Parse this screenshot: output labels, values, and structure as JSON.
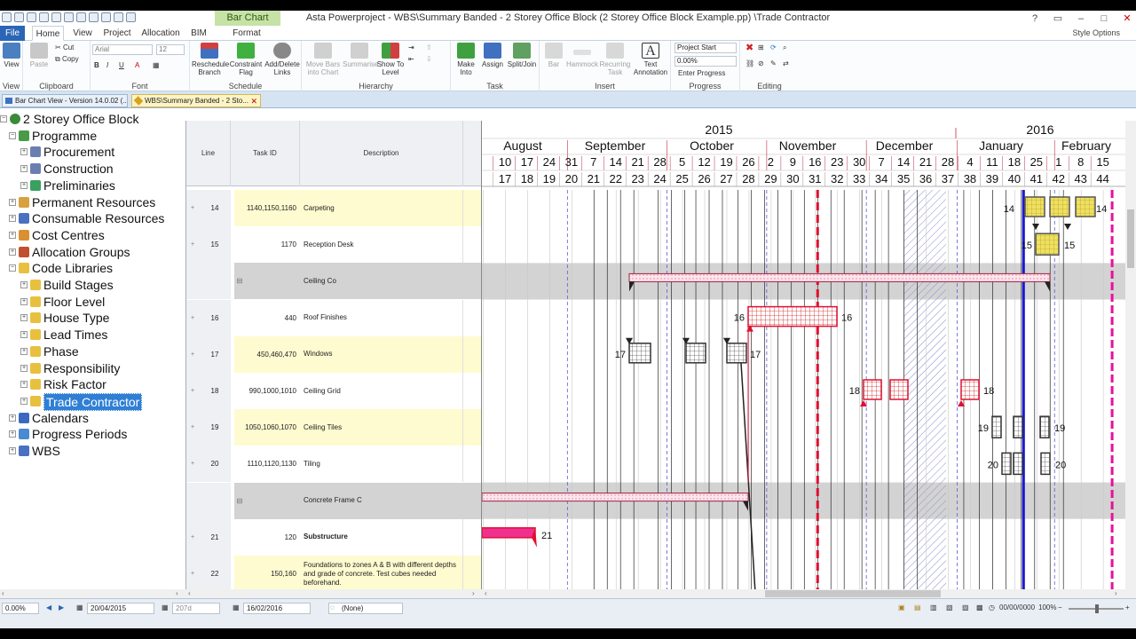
{
  "window": {
    "title": "Asta Powerproject - WBS\\Summary Banded - 2 Storey Office Block (2 Storey Office Block Example.pp) \\Trade Contractor",
    "context_tab": "Bar Chart Tools"
  },
  "ribbon_tabs": [
    "File",
    "Home",
    "View",
    "Project",
    "Allocation",
    "BIM",
    "Format"
  ],
  "style_options": "Style Options",
  "ribbon": {
    "view": "View",
    "paste": "Paste",
    "cut": "Cut",
    "copy": "Copy",
    "font_name": "Arial",
    "font_size": "12",
    "reschedule": "Reschedule",
    "branch": "Branch",
    "constraint": "Constraint",
    "flag": "Flag",
    "add_delete": "Add/Delete",
    "links": "Links",
    "move_bars": "Move Bars",
    "into_chart": "into Chart",
    "summarise": "Summarise",
    "show_to": "Show To",
    "level": "Level",
    "make": "Make",
    "into": "Into",
    "assign": "Assign",
    "split_join": "Split/Join",
    "bar": "Bar",
    "hammock": "Hammock",
    "recurring": "Recurring",
    "task": "Task",
    "text": "Text",
    "annotation": "Annotation",
    "project_start": "Project Start",
    "progress_value": "0.00%",
    "enter_progress": "Enter Progress",
    "groups": [
      "Clipboard",
      "Font",
      "Schedule",
      "Hierarchy",
      "Task",
      "Insert",
      "Progress",
      "Editing"
    ]
  },
  "doc_tabs": [
    {
      "label": "Bar Chart View - Version 14.0.02 (..."
    },
    {
      "label": "WBS\\Summary Banded - 2 Sto..."
    }
  ],
  "tree": [
    {
      "label": "2 Storey Office Block",
      "level": 0,
      "icon": "globe-icon",
      "color": "#3a8a3a"
    },
    {
      "label": "Programme",
      "level": 1,
      "icon": "programme-icon",
      "color": "#4a9a4a"
    },
    {
      "label": "Procurement",
      "level": 2,
      "icon": "folder-icon",
      "color": "#6a7fb0"
    },
    {
      "label": "Construction",
      "level": 2,
      "icon": "folder-icon",
      "color": "#6a7fb0"
    },
    {
      "label": "Preliminaries",
      "level": 2,
      "icon": "folder-icon",
      "color": "#3aa060"
    },
    {
      "label": "Permanent Resources",
      "level": 1,
      "icon": "person-icon",
      "color": "#d8a040"
    },
    {
      "label": "Consumable Resources",
      "level": 1,
      "icon": "cube-icon",
      "color": "#4a70c0"
    },
    {
      "label": "Cost Centres",
      "level": 1,
      "icon": "cost-icon",
      "color": "#d89030"
    },
    {
      "label": "Allocation Groups",
      "level": 1,
      "icon": "group-icon",
      "color": "#c05030"
    },
    {
      "label": "Code Libraries",
      "level": 1,
      "icon": "folder-icon",
      "color": "#e8c040"
    },
    {
      "label": "Build Stages",
      "level": 2,
      "icon": "folder-icon",
      "color": "#e8c040"
    },
    {
      "label": "Floor Level",
      "level": 2,
      "icon": "folder-icon",
      "color": "#e8c040"
    },
    {
      "label": "House Type",
      "level": 2,
      "icon": "folder-icon",
      "color": "#e8c040"
    },
    {
      "label": "Lead Times",
      "level": 2,
      "icon": "folder-icon",
      "color": "#e8c040"
    },
    {
      "label": "Phase",
      "level": 2,
      "icon": "folder-icon",
      "color": "#e8c040"
    },
    {
      "label": "Responsibility",
      "level": 2,
      "icon": "folder-icon",
      "color": "#e8c040"
    },
    {
      "label": "Risk Factor",
      "level": 2,
      "icon": "folder-icon",
      "color": "#e8c040"
    },
    {
      "label": "Trade Contractor",
      "level": 2,
      "icon": "folder-icon",
      "color": "#e8c040",
      "selected": true
    },
    {
      "label": "Calendars",
      "level": 1,
      "icon": "calendar-icon",
      "color": "#3a6ac0"
    },
    {
      "label": "Progress Periods",
      "level": 1,
      "icon": "progress-icon",
      "color": "#4a8ad0"
    },
    {
      "label": "WBS",
      "level": 1,
      "icon": "wbs-icon",
      "color": "#4a70c0"
    }
  ],
  "grid": {
    "headers": {
      "line": "Line",
      "task_id": "Task ID",
      "description": "Description"
    },
    "rows": [
      {
        "line": "14",
        "task_id": "1140,1150,1160",
        "desc": "Carpeting",
        "type": "task",
        "band": "yellow"
      },
      {
        "line": "15",
        "task_id": "1170",
        "desc": "Reception Desk",
        "type": "task",
        "band": "white"
      },
      {
        "line": "",
        "task_id": "",
        "desc": "Ceiling Co",
        "type": "group"
      },
      {
        "line": "16",
        "task_id": "440",
        "desc": "Roof Finishes",
        "type": "task",
        "band": "white"
      },
      {
        "line": "17",
        "task_id": "450,460,470",
        "desc": "Windows",
        "type": "task",
        "band": "yellow"
      },
      {
        "line": "18",
        "task_id": "990,1000,1010",
        "desc": "Ceiling Grid",
        "type": "task",
        "band": "white"
      },
      {
        "line": "19",
        "task_id": "1050,1060,1070",
        "desc": "Ceiling Tiles",
        "type": "task",
        "band": "yellow"
      },
      {
        "line": "20",
        "task_id": "1110,1120,1130",
        "desc": "Tiling",
        "type": "task",
        "band": "white"
      },
      {
        "line": "",
        "task_id": "",
        "desc": "Concrete Frame C",
        "type": "group"
      },
      {
        "line": "21",
        "task_id": "120",
        "desc": "Substructure",
        "type": "task",
        "band": "white",
        "bold": true
      },
      {
        "line": "22",
        "task_id": "150,160",
        "desc": "Foundations to zones A & B with different depths and grade of concrete. Test cubes needed beforehand.",
        "type": "task",
        "band": "yellow"
      }
    ]
  },
  "timescale": {
    "years": [
      {
        "label": "2015"
      },
      {
        "label": "2016"
      }
    ],
    "months": [
      "August",
      "September",
      "October",
      "November",
      "December",
      "January",
      "February"
    ],
    "days": [
      "10",
      "17",
      "24",
      "31",
      "7",
      "14",
      "21",
      "28",
      "5",
      "12",
      "19",
      "26",
      "2",
      "9",
      "16",
      "23",
      "30",
      "7",
      "14",
      "21",
      "28",
      "4",
      "11",
      "18",
      "25",
      "1",
      "8",
      "15"
    ],
    "weeks": [
      "17",
      "18",
      "19",
      "20",
      "21",
      "22",
      "23",
      "24",
      "25",
      "26",
      "27",
      "28",
      "29",
      "30",
      "31",
      "32",
      "33",
      "34",
      "35",
      "36",
      "37",
      "38",
      "39",
      "40",
      "41",
      "42",
      "43",
      "44"
    ]
  },
  "bar_labels": {
    "carpeting_l": "14",
    "carpeting_r": "14",
    "reception_l": "15",
    "reception_r": "15",
    "roof_l": "16",
    "roof_r": "16",
    "windows_l": "17",
    "windows_r": "17",
    "grid_l": "18",
    "grid_r": "18",
    "tiles_l": "19",
    "tiles_r": "19",
    "tiling_l": "20",
    "tiling_r": "20",
    "sub_r": "21"
  },
  "status": {
    "progress": "0.00%",
    "date_from": "20/04/2015",
    "duration": "207d",
    "date_to": "16/02/2016",
    "filter": "(None)",
    "time": "00/00/0000",
    "zoom": "100%"
  },
  "colors": {
    "accent": "#2b65b5",
    "yellow_band": "#fefbd0",
    "group_band": "#d3d3d3",
    "critical": "#e01030",
    "today": "#e8109a",
    "deadline": "#1a1ad0"
  }
}
